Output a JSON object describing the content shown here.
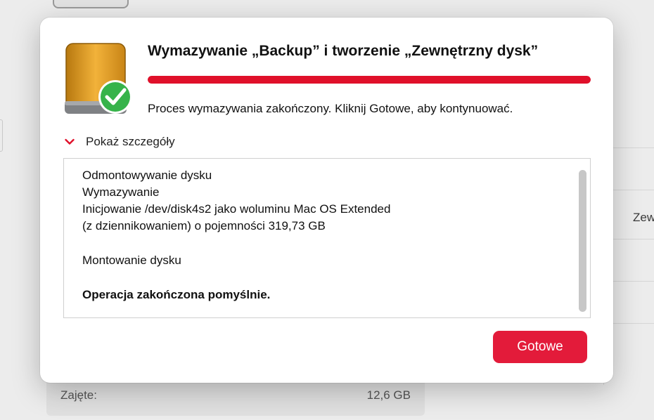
{
  "background": {
    "cut_off_text": "Zew",
    "used_label": "Zajęte:",
    "used_value": "12,6 GB"
  },
  "dialog": {
    "icon": "external-drive-icon",
    "badge_icon": "checkmark-badge-icon",
    "title": "Wymazywanie „Backup” i tworzenie „Zewnętrzny dysk”",
    "progress": {
      "percent": 100,
      "color": "#e0102a"
    },
    "status": "Proces wymazywania zakończony. Kliknij Gotowe, aby kontynuować.",
    "details_toggle": {
      "icon": "chevron-down-icon",
      "label": "Pokaż szczegóły",
      "expanded": true
    },
    "log": {
      "lines": [
        "Odmontowywanie dysku",
        "Wymazywanie",
        "Inicjowanie /dev/disk4s2 jako woluminu Mac OS Extended",
        "(z dziennikowaniem) o pojemności 319,73 GB",
        "Montowanie dysku",
        "Operacja zakończona pomyślnie."
      ]
    },
    "done_button": {
      "label": "Gotowe",
      "color": "#e31b3a"
    }
  }
}
